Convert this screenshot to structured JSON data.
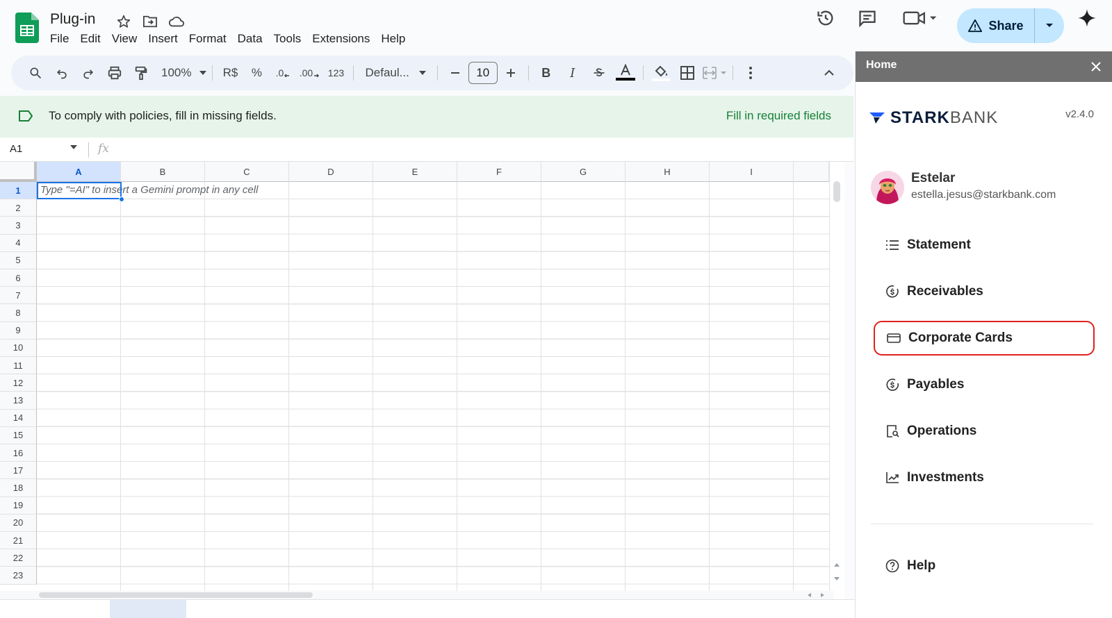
{
  "document": {
    "title": "Plug-in"
  },
  "menu": [
    "File",
    "Edit",
    "View",
    "Insert",
    "Format",
    "Data",
    "Tools",
    "Extensions",
    "Help"
  ],
  "header": {
    "share_label": "Share"
  },
  "toolbar": {
    "zoom": "100%",
    "currency": "R$",
    "percent": "%",
    "decrease_decimal": ".0",
    "increase_decimal": ".00",
    "number_format": "123",
    "font": "Defaul...",
    "font_size": "10"
  },
  "banner": {
    "message": "To comply with policies, fill in missing fields.",
    "action": "Fill in required fields"
  },
  "formula_bar": {
    "cell_ref": "A1",
    "fx": "fx"
  },
  "sheet": {
    "columns": [
      "A",
      "B",
      "C",
      "D",
      "E",
      "F",
      "G",
      "H",
      "I"
    ],
    "rows": [
      "1",
      "2",
      "3",
      "4",
      "5",
      "6",
      "7",
      "8",
      "9",
      "10",
      "11",
      "12",
      "13",
      "14",
      "15",
      "16",
      "17",
      "18",
      "19",
      "20",
      "21",
      "22",
      "23"
    ],
    "selected_column": "A",
    "selected_row": "1",
    "cell_hint": "Type \"=AI\" to insert a Gemini prompt in any cell"
  },
  "panel": {
    "title": "Home",
    "brand_bold": "STARK",
    "brand_light": "BANK",
    "version": "v2.4.0",
    "user_name": "Estelar",
    "user_email": "estella.jesus@starkbank.com",
    "nav": [
      {
        "label": "Statement",
        "icon": "list-icon"
      },
      {
        "label": "Receivables",
        "icon": "money-in-icon"
      },
      {
        "label": "Corporate Cards",
        "icon": "card-icon",
        "highlighted": true
      },
      {
        "label": "Payables",
        "icon": "money-out-icon"
      },
      {
        "label": "Operations",
        "icon": "document-search-icon"
      },
      {
        "label": "Investments",
        "icon": "chart-up-icon"
      }
    ],
    "help": "Help"
  },
  "colors": {
    "accent": "#1a73e8",
    "share_bg": "#c2e7ff",
    "banner_bg": "#e6f4ea",
    "banner_link": "#188038",
    "panel_header": "#707070",
    "highlight": "#e02020"
  }
}
